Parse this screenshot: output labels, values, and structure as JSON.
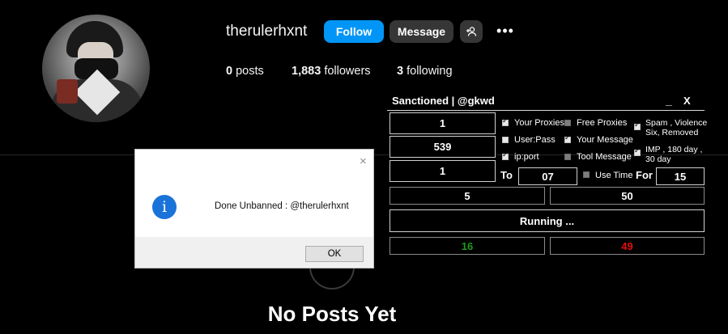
{
  "profile": {
    "username": "therulerhxnt",
    "follow_label": "Follow",
    "message_label": "Message",
    "add_user_icon": "add-user-icon",
    "more_icon": "more-options-icon",
    "stats": {
      "posts_count": "0",
      "posts_label": "posts",
      "followers_count": "1,883",
      "followers_label": "followers",
      "following_count": "3",
      "following_label": "following"
    },
    "empty_state": "No Posts Yet",
    "colors": {
      "follow_blue": "#0095f6",
      "message_gray": "#363636"
    }
  },
  "tool": {
    "title": "Sanctioned | @gkwd",
    "minimize": "_",
    "close": "X",
    "field_a": "1",
    "field_b": "539",
    "field_c": "1",
    "checks": {
      "your_proxies": "Your Proxies",
      "free_proxies": "Free Proxies",
      "user_pass": "User:Pass",
      "your_message": "Your Message",
      "ip_port": "ip:port",
      "tool_message": "Tool Message",
      "spam_line1": "Spam , Violence",
      "spam_line2": "Six, Removed",
      "imp_line1": "IMP , 180 day ,",
      "imp_line2": "30 day"
    },
    "to_label": "To",
    "to_value": "07",
    "use_time_label": "Use Time",
    "for_label": "For",
    "for_value": "15",
    "count_left": "5",
    "count_right": "50",
    "status": "Running ...",
    "success_count": "16",
    "fail_count": "49",
    "colors": {
      "success": "#1e9a1e",
      "fail": "#e01010"
    }
  },
  "dialog": {
    "close": "×",
    "icon": "info-icon",
    "message": "Done Unbanned : @therulerhxnt",
    "ok_label": "OK"
  }
}
